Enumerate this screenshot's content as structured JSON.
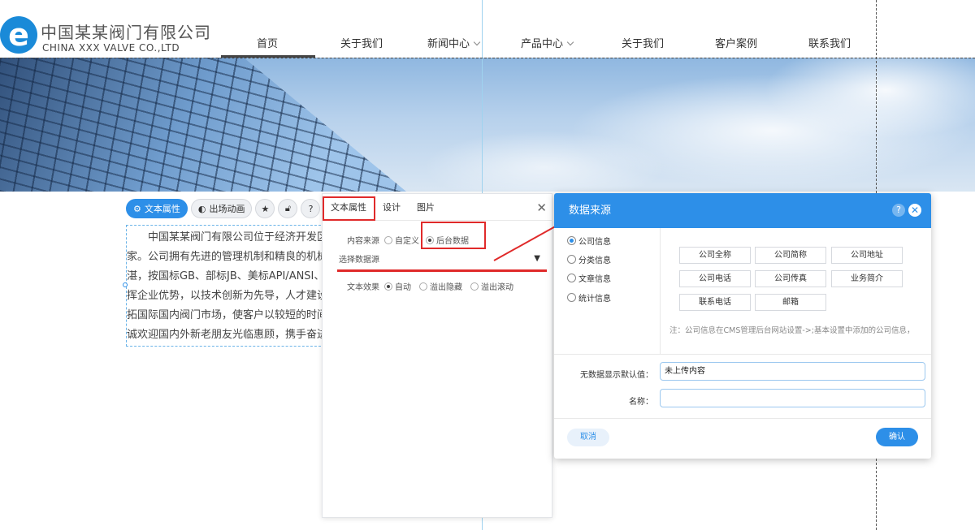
{
  "header": {
    "logo_letter": "e",
    "company_cn": "中国某某阀门有限公司",
    "company_en": "CHINA XXX VALVE CO.,LTD",
    "nav": [
      {
        "label": "首页"
      },
      {
        "label": "关于我们"
      },
      {
        "label": "新闻中心"
      },
      {
        "label": "产品中心"
      },
      {
        "label": "关于我们"
      },
      {
        "label": "客户案例"
      },
      {
        "label": "联系我们"
      }
    ]
  },
  "toolbar": {
    "text_props": "文本属性",
    "entry_anim": "出场动画"
  },
  "widget": {
    "lines": [
      "　　中国某某阀门有限公司位于经济开发区",
      "家。公司拥有先进的管理机制和精良的机械",
      "湛，按国标GB、部标JB、美标API/ANSI、",
      "挥企业优势，以技术创新为先导，人才建设",
      "拓国际国内阀门市场，使客户以较短的时间",
      "诚欢迎国内外新老朋友光临惠顾，携手奋进"
    ]
  },
  "prop_panel": {
    "tabs": [
      "文本属性",
      "设计",
      "图片"
    ],
    "close": "✕",
    "content_source_label": "内容来源",
    "opt_custom": "自定义",
    "opt_backend": "后台数据",
    "select_placeholder": "选择数据源",
    "text_effect_label": "文本效果",
    "effect_auto": "自动",
    "effect_hide": "溢出隐藏",
    "effect_scroll": "溢出滚动"
  },
  "dialog": {
    "title": "数据来源",
    "help": "?",
    "close": "✕",
    "sources": [
      "公司信息",
      "分类信息",
      "文章信息",
      "统计信息"
    ],
    "fields": [
      "公司全称",
      "公司简称",
      "公司地址",
      "公司电话",
      "公司传真",
      "业务简介",
      "联系电话",
      "邮箱"
    ],
    "note": "注：公司信息在CMS管理后台网站设置->;基本设置中添加的公司信息，",
    "default_label": "无数据显示默认值：",
    "default_value": "未上传内容",
    "name_label": "名称：",
    "name_value": "",
    "cancel": "取消",
    "ok": "确认"
  },
  "colors": {
    "accent": "#2d8fe8",
    "annotation_red": "#e02a2a"
  }
}
